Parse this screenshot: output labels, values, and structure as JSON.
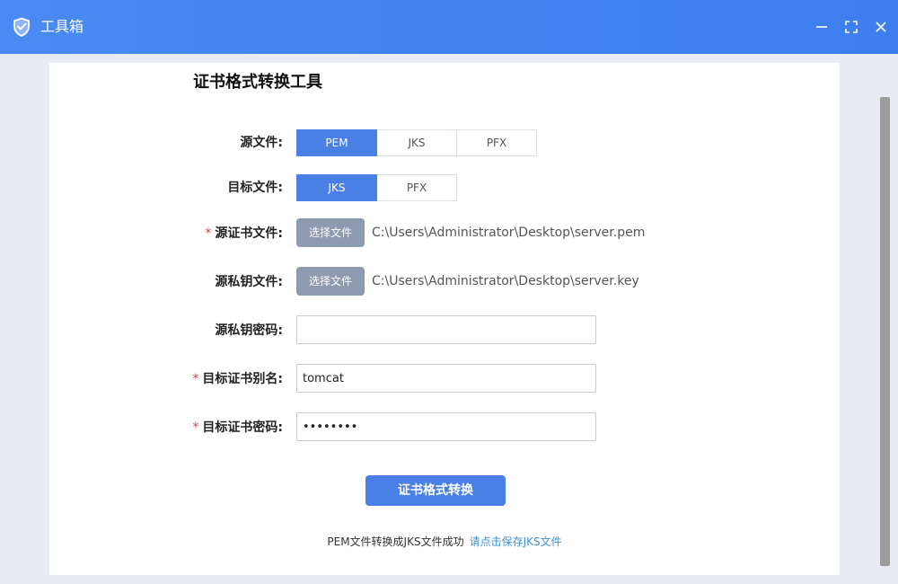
{
  "window": {
    "title": "工具箱",
    "accent_color": "#4a7fe5",
    "titlebar_color": "#3f82f0"
  },
  "icons": {
    "app": "shield-check-icon",
    "minimize": "minimize-icon",
    "maximize": "maximize-icon",
    "close": "close-icon"
  },
  "page": {
    "title": "证书格式转换工具"
  },
  "form": {
    "source_format": {
      "label": "源文件:",
      "options": [
        "PEM",
        "JKS",
        "PFX"
      ],
      "selected": "PEM"
    },
    "target_format": {
      "label": "目标文件:",
      "options": [
        "JKS",
        "PFX"
      ],
      "selected": "JKS"
    },
    "source_cert": {
      "required_mark": "*",
      "label": "源证书文件:",
      "button_label": "选择文件",
      "path": "C:\\Users\\Administrator\\Desktop\\server.pem"
    },
    "source_key": {
      "label": "源私钥文件:",
      "button_label": "选择文件",
      "path": "C:\\Users\\Administrator\\Desktop\\server.key"
    },
    "source_key_password": {
      "label": "源私钥密码:",
      "value": ""
    },
    "target_alias": {
      "required_mark": "*",
      "label": "目标证书别名:",
      "value": "tomcat"
    },
    "target_password": {
      "required_mark": "*",
      "label": "目标证书密码:",
      "value": "••••••••"
    },
    "submit_label": "证书格式转换"
  },
  "status": {
    "message": "PEM文件转换成JKS文件成功",
    "link_text": "请点击保存JKS文件"
  }
}
